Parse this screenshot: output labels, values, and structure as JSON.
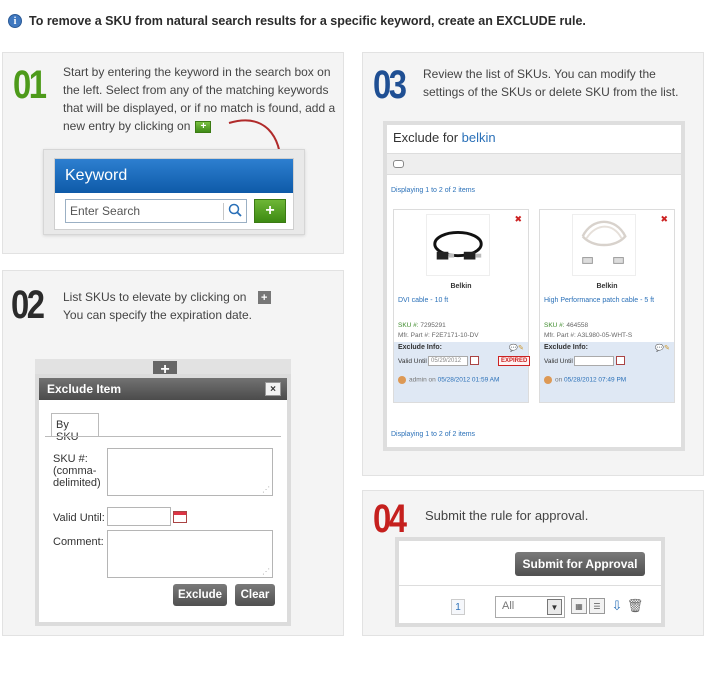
{
  "header": {
    "icon": "info-icon",
    "text": "To remove a SKU from natural search results for a specific keyword, create an EXCLUDE rule."
  },
  "step1": {
    "number": "01",
    "text": "Start by entering the keyword in the search box on the left. Select from any of the matching keywords that will be displayed, or if no match is found, add a new entry by clicking on",
    "keyword_title": "Keyword",
    "search_placeholder": "Enter Search",
    "add_label": "+"
  },
  "step2": {
    "number": "02",
    "text_line1": "List SKUs to elevate by clicking on",
    "text_line2": "You can specify the expiration date.",
    "plus_label": "+",
    "dialog_title": "Exclude Item",
    "close_label": "×",
    "tab_label": "By SKU",
    "sku_label": "SKU #:\n(comma-\ndelimited)",
    "valid_until_label": "Valid Until:",
    "comment_label": "Comment:",
    "exclude_button": "Exclude",
    "clear_button": "Clear"
  },
  "step3": {
    "number": "03",
    "text": "Review the list of SKUs. You can modify the settings of the SKUs or delete SKU from the list.",
    "panel_prefix": "Exclude for",
    "keyword": "belkin",
    "displaying": "Displaying 1 to 2 of 2 items",
    "items": [
      {
        "brand": "Belkin",
        "name": "DVI cable - 10 ft",
        "sku_key": "SKU #:",
        "sku": "7295291",
        "mfr_key": "Mfr. Part #:",
        "mfr": "F2E7171-10-DV",
        "exclude_info": "Exclude Info:",
        "valid_until": "Valid Until",
        "date": "05/29/2012",
        "status": "EXPIRED",
        "user": "admin",
        "on": "on",
        "timestamp": "05/28/2012 01:59 AM"
      },
      {
        "brand": "Belkin",
        "name": "High Performance patch cable - 5 ft",
        "sku_key": "SKU #:",
        "sku": "464558",
        "mfr_key": "Mfr. Part #:",
        "mfr": "A3L980-05-WHT-S",
        "exclude_info": "Exclude Info:",
        "valid_until": "Valid Until",
        "date": "",
        "status": "",
        "user": "",
        "on": "on",
        "timestamp": "05/28/2012 07:49 PM"
      }
    ]
  },
  "step4": {
    "number": "04",
    "text": "Submit the rule for approval.",
    "submit_button": "Submit for Approval",
    "page": "1",
    "filter_value": "All"
  },
  "colors": {
    "green": "#4d9a1a",
    "blue": "#1f4f93",
    "red": "#c5201e",
    "dark": "#2b2b2b",
    "link": "#2a70b8"
  }
}
